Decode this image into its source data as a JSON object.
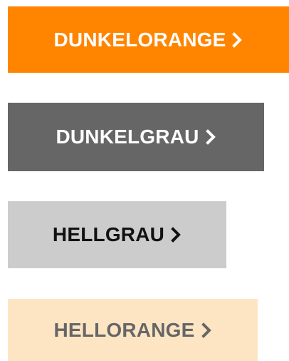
{
  "buttons": [
    {
      "label": "DUNKELORANGE",
      "icon": "chevron-right-icon",
      "bg": "#FF8500",
      "fg": "#FFFFFF"
    },
    {
      "label": "DUNKELGRAU",
      "icon": "chevron-right-icon",
      "bg": "#666666",
      "fg": "#FFFFFF"
    },
    {
      "label": "HELLGRAU",
      "icon": "chevron-right-icon",
      "bg": "#CCCCCC",
      "fg": "#111111"
    },
    {
      "label": "HELLORANGE",
      "icon": "chevron-right-icon",
      "bg": "#FDE5C3",
      "fg": "#666666"
    }
  ]
}
